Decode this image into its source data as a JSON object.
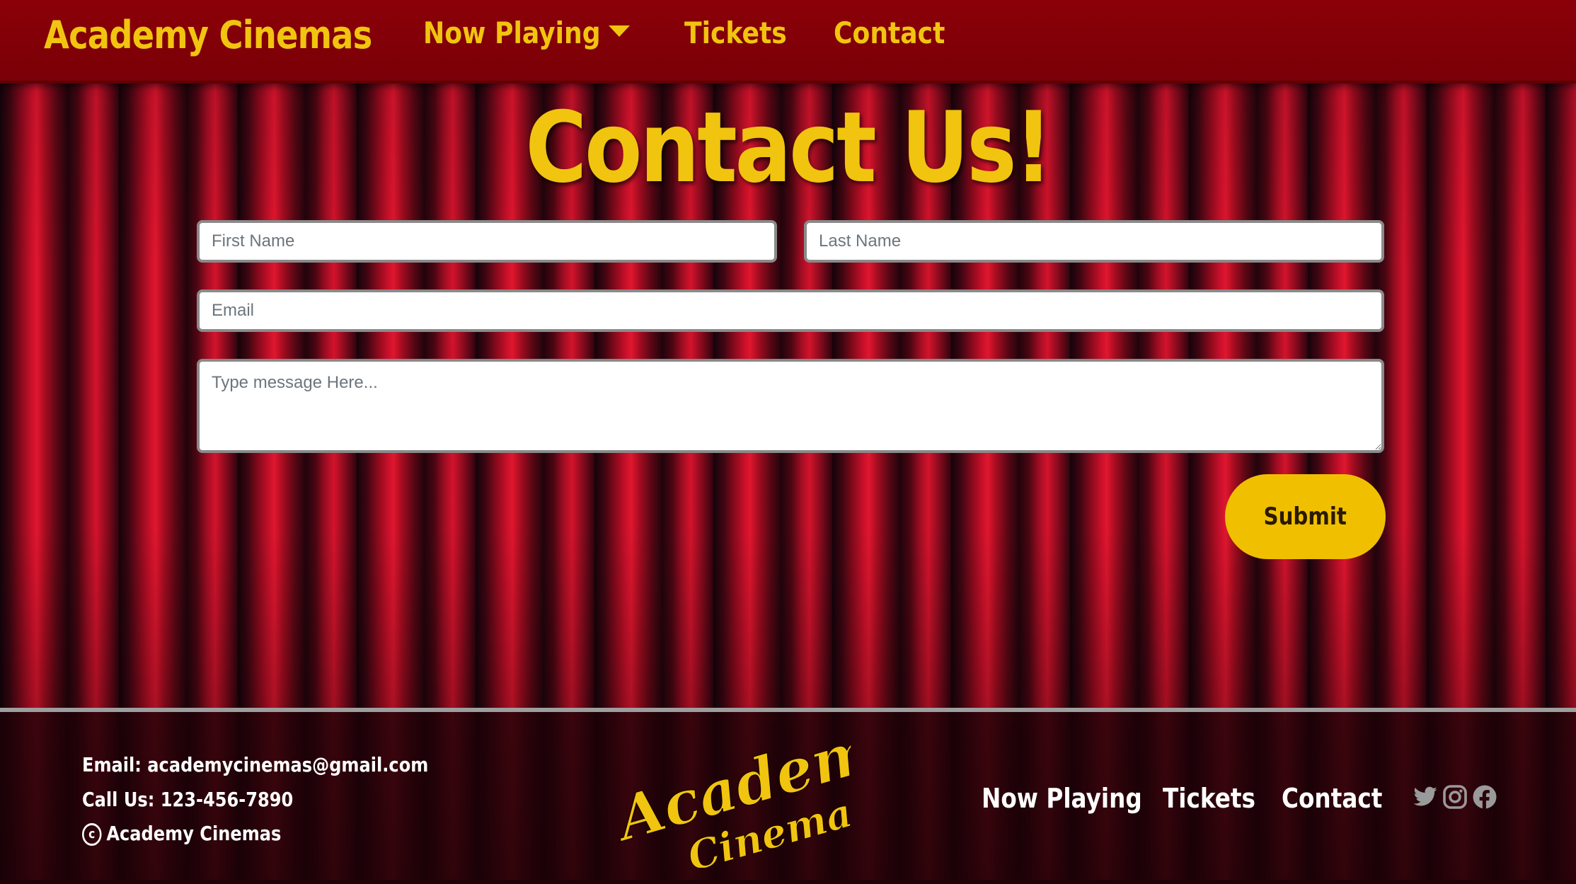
{
  "navbar": {
    "brand": "Academy Cinemas",
    "items": [
      {
        "label": "Now Playing",
        "has_dropdown": true
      },
      {
        "label": "Tickets"
      },
      {
        "label": "Contact"
      }
    ]
  },
  "main": {
    "heading": "Contact Us!",
    "form": {
      "first_name_placeholder": "First Name",
      "last_name_placeholder": "Last Name",
      "email_placeholder": "Email",
      "message_placeholder": "Type message Here...",
      "first_name_value": "",
      "last_name_value": "",
      "email_value": "",
      "message_value": "",
      "submit_label": "Submit"
    }
  },
  "footer": {
    "email_line": "Email: academycinemas@gmail.com",
    "phone_line": "Call Us: 123-456-7890",
    "copyright_symbol": "c",
    "copyright_line": "Academy Cinemas",
    "logo_text": [
      "Academy",
      "Cinemas"
    ],
    "nav": [
      {
        "label": "Now Playing"
      },
      {
        "label": "Tickets"
      },
      {
        "label": "Contact"
      }
    ],
    "social_icons": [
      "twitter-icon",
      "instagram-icon",
      "facebook-icon"
    ]
  },
  "colors": {
    "navbar_bg": "#8b0008",
    "accent_yellow": "#f1c40f",
    "submit_bg": "#f0c000",
    "footer_text": "#ffffff"
  }
}
